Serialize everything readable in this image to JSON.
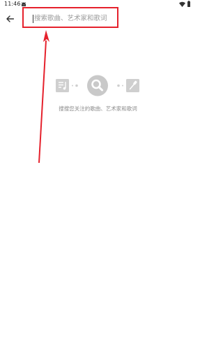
{
  "status_bar": {
    "time": "11:46",
    "icons": [
      "robot-icon",
      "wifi-icon",
      "battery-icon"
    ]
  },
  "search": {
    "placeholder": "搜索歌曲、艺术家和歌词",
    "value": "",
    "highlight_color": "#e5212c"
  },
  "navigation": {
    "back_icon": "arrow-left-icon"
  },
  "empty_state": {
    "icons": [
      "music-note-icon",
      "search-icon",
      "microphone-icon"
    ],
    "hint": "搜搜您关注的歌曲、艺术家和歌词"
  },
  "colors": {
    "annotation": "#e5212c",
    "illustration_gray": "#c9c9c9",
    "hint_gray": "#8a8a8a"
  }
}
